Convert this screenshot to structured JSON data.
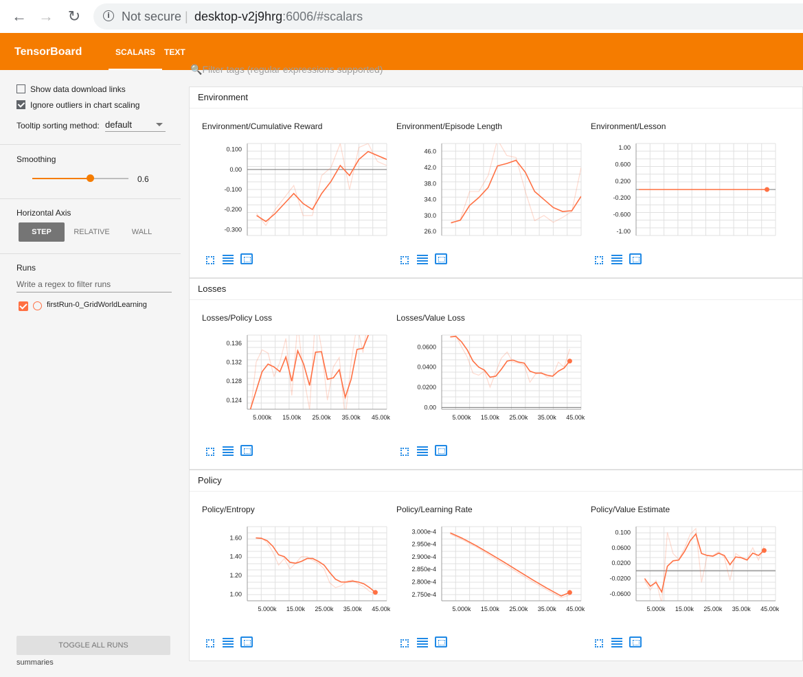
{
  "browser": {
    "not_secure": "Not secure",
    "host": "desktop-v2j9hrg",
    "rest": ":6006/#scalars"
  },
  "header": {
    "brand": "TensorBoard",
    "tabs": [
      "SCALARS",
      "TEXT"
    ]
  },
  "sidebar": {
    "show_download": "Show data download links",
    "ignore_outliers": "Ignore outliers in chart scaling",
    "tooltip_label": "Tooltip sorting method:",
    "tooltip_value": "default",
    "smoothing_label": "Smoothing",
    "smoothing_value": 0.6,
    "smoothing_text": "0.6",
    "horizontal_axis": "Horizontal Axis",
    "axis_step": "STEP",
    "axis_relative": "RELATIVE",
    "axis_wall": "WALL",
    "runs_label": "Runs",
    "runs_filter_placeholder": "Write a regex to filter runs",
    "run_name": "firstRun-0_GridWorldLearning",
    "toggle_all": "TOGGLE ALL RUNS",
    "summaries": "summaries"
  },
  "main": {
    "filter_placeholder": "Filter tags (regular expressions supported)",
    "sections": [
      "Environment",
      "Losses",
      "Policy"
    ]
  },
  "colors": {
    "accent": "#f57c00",
    "series": "#ff7043",
    "icon": "#1e88e5"
  },
  "chart_data": [
    {
      "type": "line",
      "title": "Environment/Cumulative Reward",
      "yticks": [
        "0.100",
        "0.00",
        "-0.100",
        "-0.200",
        "-0.300"
      ],
      "ylim": [
        -0.33,
        0.13
      ],
      "xticks": [],
      "x": [
        2,
        4,
        6,
        8,
        10,
        12,
        14,
        16,
        18,
        20,
        22,
        24,
        26,
        28,
        30
      ],
      "values": [
        -0.23,
        -0.26,
        -0.22,
        -0.17,
        -0.12,
        -0.17,
        -0.2,
        -0.12,
        -0.06,
        0.02,
        -0.03,
        0.05,
        0.09,
        0.07,
        0.05
      ],
      "raw": [
        -0.22,
        -0.28,
        -0.2,
        -0.14,
        -0.08,
        -0.23,
        -0.23,
        -0.03,
        0.01,
        0.13,
        -0.1,
        0.11,
        0.13,
        0.04,
        0.02
      ],
      "xlim": [
        0,
        30
      ],
      "endpoint": false
    },
    {
      "type": "line",
      "title": "Environment/Episode Length",
      "yticks": [
        "46.0",
        "42.0",
        "38.0",
        "34.0",
        "30.0",
        "26.0"
      ],
      "ylim": [
        25,
        48
      ],
      "xticks": [],
      "x": [
        2,
        4,
        6,
        8,
        10,
        12,
        14,
        16,
        18,
        20,
        22,
        24,
        26,
        28,
        30
      ],
      "values": [
        28.2,
        28.8,
        32.5,
        34.5,
        37,
        42.4,
        43,
        43.8,
        40.8,
        36,
        34,
        32,
        31,
        31.2,
        34.8
      ],
      "raw": [
        28,
        29,
        36,
        36,
        40,
        49,
        45,
        44.5,
        36,
        28.7,
        30,
        28.3,
        29.5,
        31,
        42
      ],
      "xlim": [
        0,
        30
      ],
      "endpoint": false
    },
    {
      "type": "line",
      "title": "Environment/Lesson",
      "yticks": [
        "1.00",
        "0.600",
        "0.200",
        "-0.200",
        "-0.600",
        "-1.00"
      ],
      "ylim": [
        -1.1,
        1.1
      ],
      "xticks": [],
      "x": [
        0,
        45
      ],
      "values": [
        0,
        0
      ],
      "raw": [
        0,
        0
      ],
      "xlim": [
        -1,
        48
      ],
      "endpoint": true
    },
    {
      "type": "line",
      "title": "Losses/Policy Loss",
      "yticks": [
        "0.136",
        "0.132",
        "0.128",
        "0.124"
      ],
      "ylim": [
        0.1221,
        0.1377
      ],
      "xticks": [
        "5.000k",
        "15.00k",
        "25.00k",
        "35.00k",
        "45.00k"
      ],
      "x": [
        1,
        3,
        5,
        7,
        9,
        11,
        13,
        15,
        17,
        19,
        21,
        23,
        25,
        27,
        29,
        31,
        33,
        35,
        37,
        39,
        41,
        43
      ],
      "values": [
        0.122,
        0.126,
        0.13,
        0.1316,
        0.131,
        0.13,
        0.1331,
        0.128,
        0.1344,
        0.1316,
        0.1271,
        0.1341,
        0.1342,
        0.1284,
        0.1287,
        0.1304,
        0.1246,
        0.1284,
        0.1347,
        0.1349,
        0.138,
        0.14
      ],
      "raw": [
        0.121,
        0.132,
        0.1346,
        0.1339,
        0.129,
        0.132,
        0.137,
        0.125,
        0.14,
        0.129,
        0.122,
        0.142,
        0.135,
        0.124,
        0.131,
        0.133,
        0.12,
        0.132,
        0.14,
        0.134,
        0.142,
        0.145
      ],
      "xlim": [
        0,
        47
      ],
      "endpoint": false
    },
    {
      "type": "line",
      "title": "Losses/Value Loss",
      "yticks": [
        "0.0600",
        "0.0400",
        "0.0200",
        "0.00"
      ],
      "ylim": [
        -0.0018,
        0.0718
      ],
      "xticks": [
        "5.000k",
        "15.00k",
        "25.00k",
        "35.00k",
        "45.00k"
      ],
      "x": [
        1,
        3,
        5,
        7,
        9,
        11,
        13,
        15,
        17,
        19,
        21,
        23,
        25,
        27,
        29,
        31,
        33,
        35,
        37,
        39,
        41,
        43
      ],
      "values": [
        0.07,
        0.0705,
        0.065,
        0.057,
        0.046,
        0.04,
        0.037,
        0.03,
        0.031,
        0.038,
        0.046,
        0.047,
        0.045,
        0.044,
        0.036,
        0.034,
        0.034,
        0.032,
        0.031,
        0.036,
        0.039,
        0.046
      ],
      "raw": [
        0.07,
        0.071,
        0.06,
        0.05,
        0.034,
        0.032,
        0.036,
        0.02,
        0.035,
        0.049,
        0.055,
        0.045,
        0.044,
        0.042,
        0.025,
        0.033,
        0.035,
        0.03,
        0.031,
        0.045,
        0.04,
        0.058
      ],
      "xlim": [
        -2,
        47
      ],
      "endpoint": true
    },
    {
      "type": "line",
      "title": "Policy/Entropy",
      "yticks": [
        "1.60",
        "1.40",
        "1.20",
        "1.00"
      ],
      "ylim": [
        0.93,
        1.72
      ],
      "xticks": [
        "5.000k",
        "15.00k",
        "25.00k",
        "35.00k",
        "45.00k"
      ],
      "x": [
        1,
        3,
        5,
        7,
        9,
        11,
        13,
        15,
        17,
        19,
        21,
        23,
        25,
        27,
        29,
        31,
        33,
        35,
        37,
        39,
        41,
        43
      ],
      "values": [
        1.6,
        1.595,
        1.57,
        1.51,
        1.42,
        1.4,
        1.34,
        1.33,
        1.35,
        1.38,
        1.38,
        1.35,
        1.31,
        1.23,
        1.16,
        1.13,
        1.13,
        1.14,
        1.13,
        1.11,
        1.07,
        1.02
      ],
      "raw": [
        1.6,
        1.6,
        1.55,
        1.45,
        1.31,
        1.38,
        1.27,
        1.33,
        1.4,
        1.4,
        1.36,
        1.33,
        1.27,
        1.12,
        1.07,
        1.09,
        1.14,
        1.15,
        1.11,
        1.08,
        1.03,
        1.0
      ],
      "xlim": [
        -2,
        47
      ],
      "endpoint": true
    },
    {
      "type": "line",
      "title": "Policy/Learning Rate",
      "yticks": [
        "3.000e-4",
        "2.950e-4",
        "2.900e-4",
        "2.850e-4",
        "2.800e-4",
        "2.750e-4"
      ],
      "ylim": [
        0.0002725,
        0.000302
      ],
      "xticks": [
        "5.000k",
        "15.00k",
        "25.00k",
        "35.00k",
        "45.00k"
      ],
      "x": [
        1,
        5,
        10,
        15,
        20,
        25,
        30,
        35,
        40,
        43
      ],
      "values": [
        0.0002995,
        0.0002975,
        0.0002945,
        0.0002912,
        0.0002878,
        0.0002843,
        0.0002808,
        0.0002775,
        0.0002744,
        0.0002758
      ],
      "raw": [
        0.000299,
        0.000297,
        0.000294,
        0.0002905,
        0.000287,
        0.0002835,
        0.00028,
        0.0002768,
        0.0002737,
        0.0002748
      ],
      "xlim": [
        -2,
        47
      ],
      "endpoint": true
    },
    {
      "type": "line",
      "title": "Policy/Value Estimate",
      "yticks": [
        "0.100",
        "0.0600",
        "0.0200",
        "-0.0200",
        "-0.0600"
      ],
      "ylim": [
        -0.078,
        0.115
      ],
      "xticks": [
        "5.000k",
        "15.00k",
        "25.00k",
        "35.00k",
        "45.00k"
      ],
      "x": [
        1,
        3,
        5,
        7,
        9,
        11,
        13,
        15,
        17,
        19,
        21,
        23,
        25,
        27,
        29,
        31,
        33,
        35,
        37,
        39,
        41,
        43
      ],
      "values": [
        -0.02,
        -0.04,
        -0.03,
        -0.055,
        0.012,
        0.026,
        0.028,
        0.05,
        0.078,
        0.096,
        0.045,
        0.04,
        0.038,
        0.046,
        0.04,
        0.016,
        0.036,
        0.034,
        0.028,
        0.046,
        0.04,
        0.053
      ],
      "raw": [
        -0.025,
        -0.05,
        -0.025,
        -0.085,
        0.1,
        0.045,
        0.03,
        0.058,
        0.095,
        0.11,
        -0.03,
        0.04,
        0.04,
        0.05,
        0.035,
        -0.025,
        0.045,
        0.035,
        0.03,
        0.06,
        0.028,
        0.065
      ],
      "xlim": [
        -2,
        47
      ],
      "endpoint": true
    }
  ]
}
